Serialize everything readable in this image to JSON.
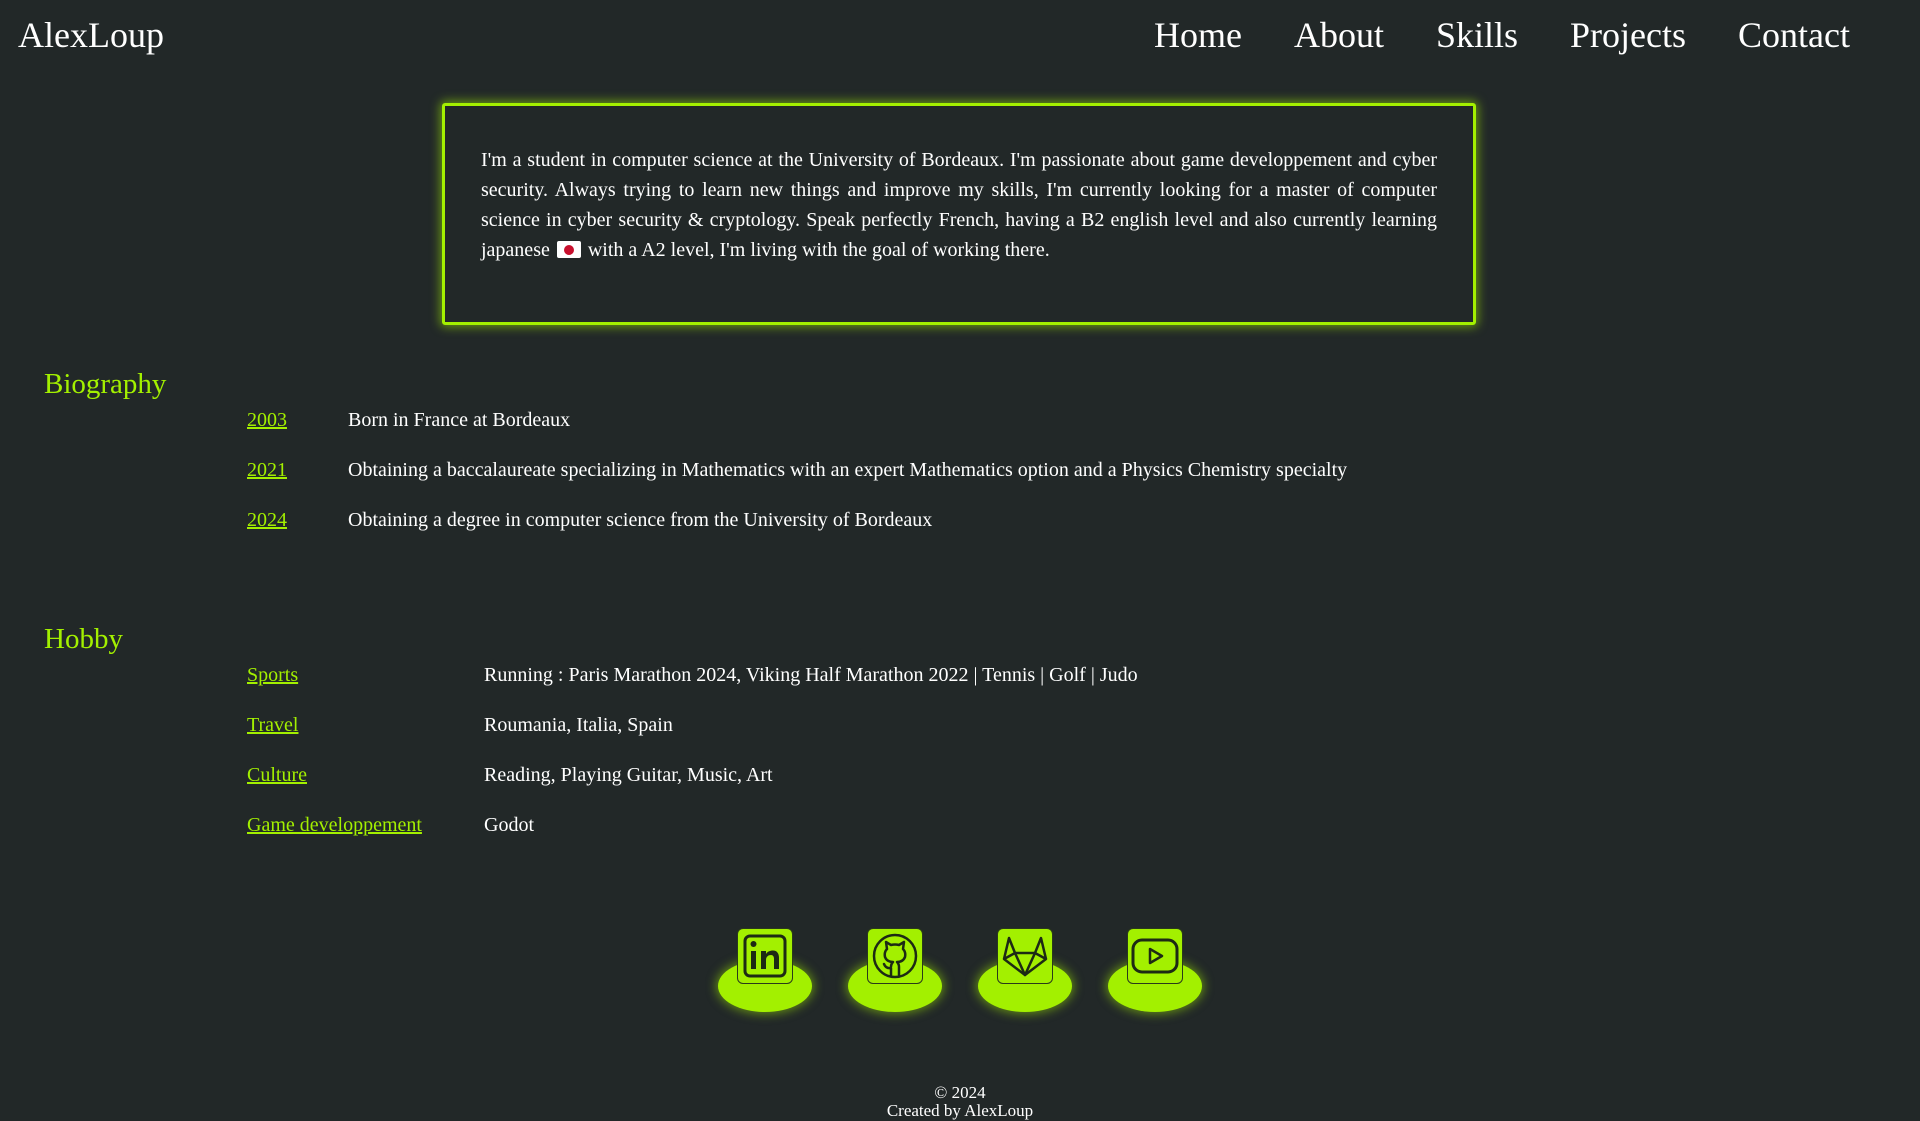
{
  "header": {
    "brand": "AlexLoup",
    "nav": [
      "Home",
      "About",
      "Skills",
      "Projects",
      "Contact"
    ]
  },
  "about": {
    "text_before_flag": "I'm a student in computer science at the University of Bordeaux. I'm passionate about game developpement and cyber security. Always trying to learn new things and improve my skills, I'm currently looking for a master of computer science in cyber security & cryptology. Speak perfectly French, having a B2 english level and also currently learning japanese ",
    "text_after_flag": " with a A2 level, I'm living with the goal of working there."
  },
  "biography": {
    "title": "Biography",
    "items": [
      {
        "year": "2003",
        "text": "Born in France at Bordeaux"
      },
      {
        "year": "2021",
        "text": "Obtaining a baccalaureate specializing in Mathematics with an expert Mathematics option and a Physics Chemistry specialty"
      },
      {
        "year": "2024",
        "text": "Obtaining a degree in computer science from the University of Bordeaux"
      }
    ]
  },
  "hobby": {
    "title": "Hobby",
    "items": [
      {
        "name": "Sports",
        "text": "Running : Paris Marathon 2024, Viking Half Marathon 2022 | Tennis | Golf | Judo"
      },
      {
        "name": "Travel",
        "text": "Roumania, Italia, Spain"
      },
      {
        "name": "Culture",
        "text": "Reading, Playing Guitar, Music, Art"
      },
      {
        "name": "Game developpement",
        "text": "Godot"
      }
    ]
  },
  "socials": {
    "icons": [
      "linkedin-icon",
      "github-icon",
      "gitlab-icon",
      "youtube-icon"
    ]
  },
  "colors": {
    "background": "#222828",
    "accent": "#a3f000",
    "text": "#ffffff"
  },
  "footer": {
    "copyright": "© 2024",
    "credit": "Created by AlexLoup"
  }
}
